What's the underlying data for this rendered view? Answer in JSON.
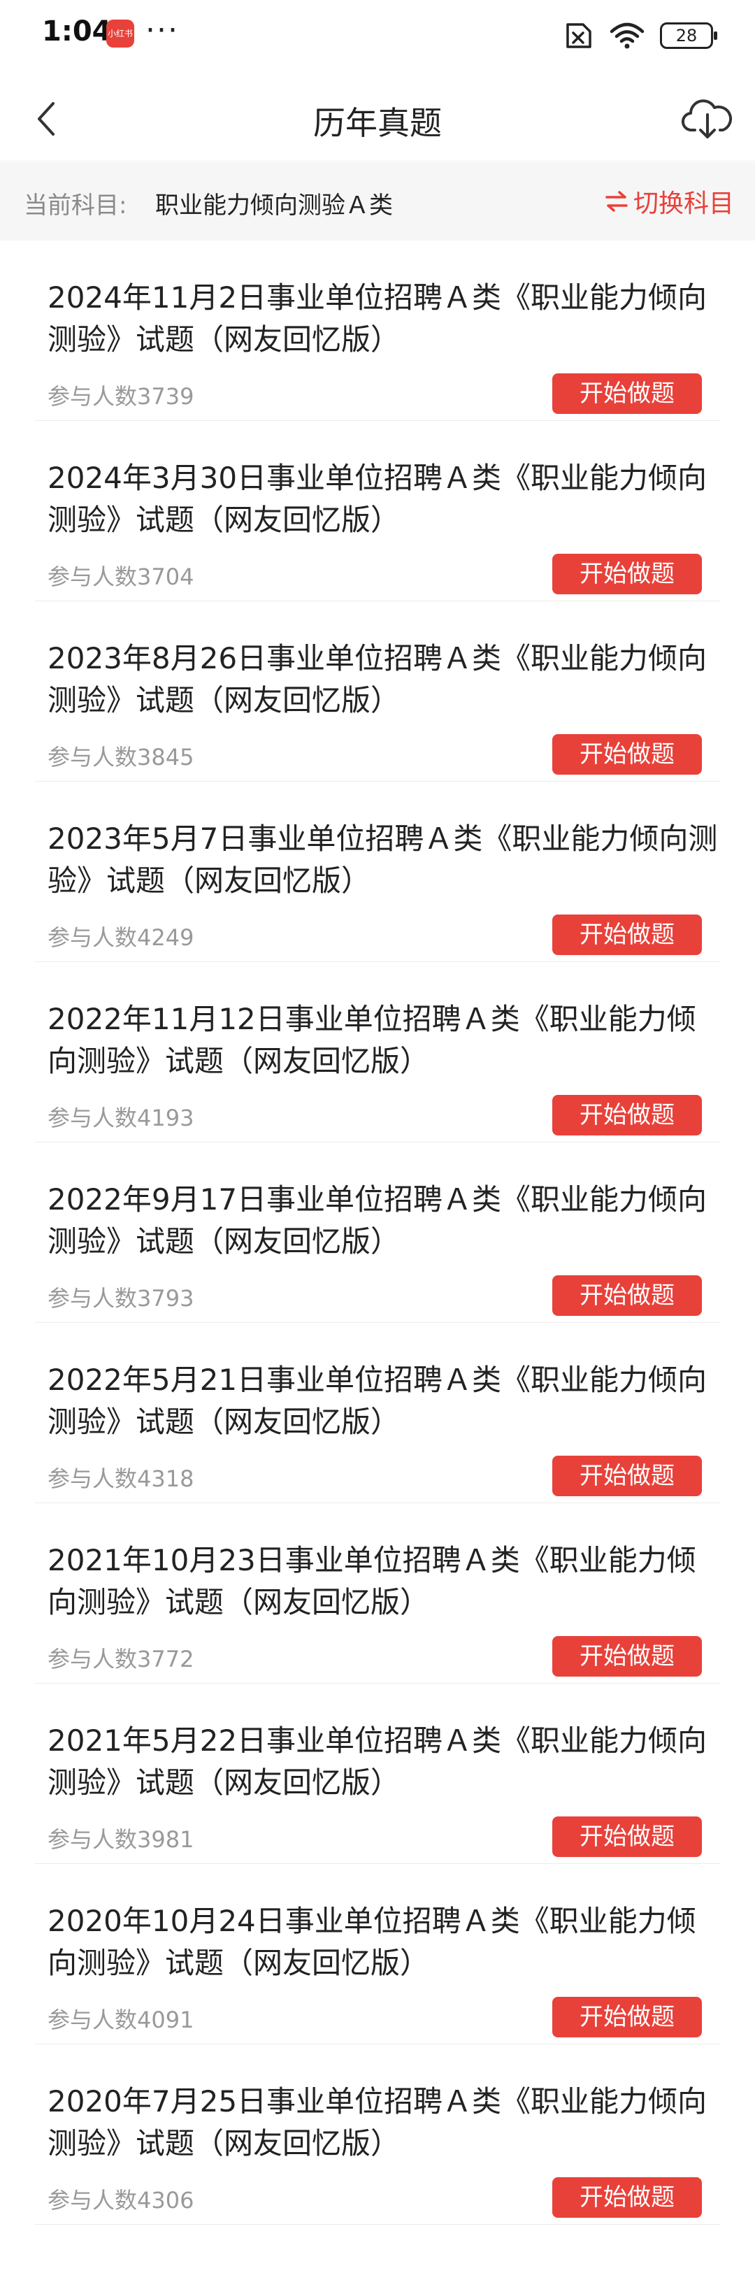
{
  "status_bar": {
    "time": "1:04",
    "app_badge": "小红书",
    "more": "···",
    "battery": "28"
  },
  "header": {
    "title": "历年真题"
  },
  "subject": {
    "label": "当前科目:",
    "value": "职业能力倾向测验Ａ类",
    "switch_label": "切换科目"
  },
  "colors": {
    "accent": "#e8413a",
    "muted": "#999999"
  },
  "icons": {
    "back": "chevron-left-icon",
    "download": "cloud-download-icon",
    "switch": "swap-arrows-icon"
  },
  "exams": [
    {
      "title": "2024年11月2日事业单位招聘Ａ类《职业能力倾向测验》试题（网友回忆版）",
      "count": "参与人数3739",
      "button": "开始做题"
    },
    {
      "title": "2024年3月30日事业单位招聘Ａ类《职业能力倾向测验》试题（网友回忆版）",
      "count": "参与人数3704",
      "button": "开始做题"
    },
    {
      "title": "2023年8月26日事业单位招聘Ａ类《职业能力倾向测验》试题（网友回忆版）",
      "count": "参与人数3845",
      "button": "开始做题"
    },
    {
      "title": "2023年5月7日事业单位招聘Ａ类《职业能力倾向测验》试题（网友回忆版）",
      "count": "参与人数4249",
      "button": "开始做题"
    },
    {
      "title": "2022年11月12日事业单位招聘Ａ类《职业能力倾向测验》试题（网友回忆版）",
      "count": "参与人数4193",
      "button": "开始做题"
    },
    {
      "title": "2022年9月17日事业单位招聘Ａ类《职业能力倾向测验》试题（网友回忆版）",
      "count": "参与人数3793",
      "button": "开始做题"
    },
    {
      "title": "2022年5月21日事业单位招聘Ａ类《职业能力倾向测验》试题（网友回忆版）",
      "count": "参与人数4318",
      "button": "开始做题"
    },
    {
      "title": "2021年10月23日事业单位招聘Ａ类《职业能力倾向测验》试题（网友回忆版）",
      "count": "参与人数3772",
      "button": "开始做题"
    },
    {
      "title": "2021年5月22日事业单位招聘Ａ类《职业能力倾向测验》试题（网友回忆版）",
      "count": "参与人数3981",
      "button": "开始做题"
    },
    {
      "title": "2020年10月24日事业单位招聘Ａ类《职业能力倾向测验》试题（网友回忆版）",
      "count": "参与人数4091",
      "button": "开始做题"
    },
    {
      "title": "2020年7月25日事业单位招聘Ａ类《职业能力倾向测验》试题（网友回忆版）",
      "count": "参与人数4306",
      "button": "开始做题"
    }
  ]
}
